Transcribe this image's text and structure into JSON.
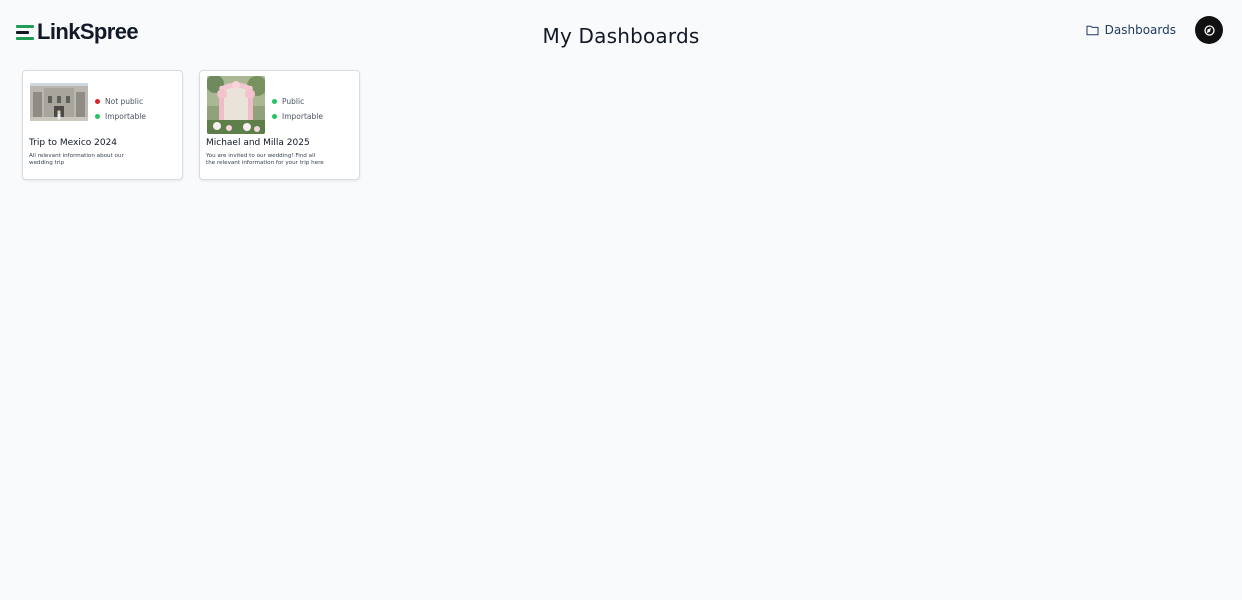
{
  "header": {
    "logo_text": "LinkSpree",
    "page_title": "My Dashboards",
    "nav_label": "Dashboards",
    "nav_icon": "folder-icon",
    "avatar_icon": "user-avatar-icon"
  },
  "colors": {
    "background": "#f9fafb",
    "brand_green": "#1f9d55",
    "status_red": "#dc2626",
    "status_green": "#22c55e",
    "nav_text": "#1e3a5f"
  },
  "dashboards": [
    {
      "title": "Trip to Mexico 2024",
      "description": "All relevant information about our wedding trip",
      "visibility": "Not public",
      "visibility_color": "#dc2626",
      "import_status": "Importable",
      "import_color": "#22c55e"
    },
    {
      "title": "Michael and Milla 2025",
      "description": "You are invited to our wedding! Find all the relevant information for your trip here",
      "visibility": "Public",
      "visibility_color": "#22c55e",
      "import_status": "Importable",
      "import_color": "#22c55e"
    }
  ]
}
